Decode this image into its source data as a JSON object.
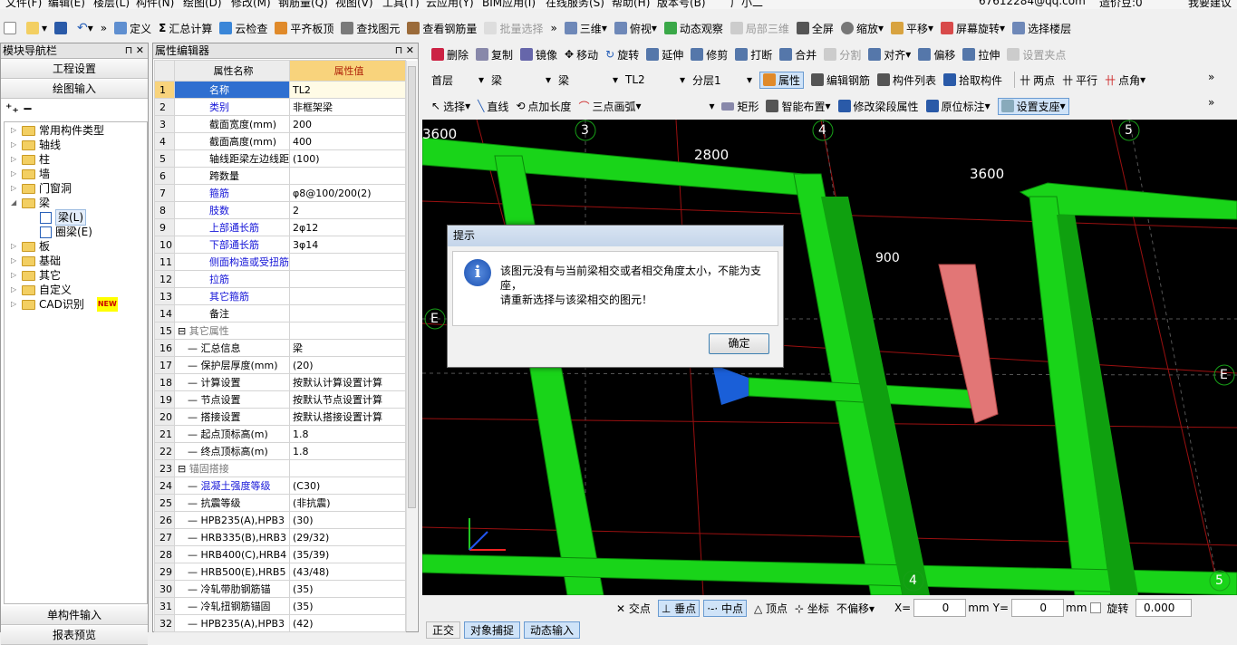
{
  "menu": {
    "items": [
      "文件(F)",
      "编辑(E)",
      "楼层(L)",
      "构件(N)",
      "绘图(D)",
      "修改(M)",
      "钢筋量(Q)",
      "视图(V)",
      "工具(T)",
      "云应用(Y)",
      "BIM应用(I)",
      "在线服务(S)",
      "帮助(H)",
      "版本号(B)",
      "广小二"
    ],
    "account": "6761228​4@qq.com",
    "coins": "造价豆:0",
    "feedback": "我要建议"
  },
  "toolbar1": {
    "define": "定义",
    "sum": "汇总计算",
    "cloud_check": "云检查",
    "align_top": "平齐板顶",
    "find": "查找图元",
    "view_rebar": "查看钢筋量",
    "batch_select": "批量选择",
    "three_d": "三维",
    "top_view": "俯视",
    "dynamic": "动态观察",
    "local_3d": "局部三维",
    "fullscreen": "全屏",
    "zoom": "缩放",
    "pan": "平移",
    "rotate_screen": "屏幕旋转",
    "select_floor": "选择楼层"
  },
  "toolbar2": {
    "delete": "删除",
    "copy": "复制",
    "mirror": "镜像",
    "move": "移动",
    "rotate": "旋转",
    "extend": "延伸",
    "trim": "修剪",
    "break": "打断",
    "merge": "合并",
    "split": "分割",
    "align": "对齐",
    "offset": "偏移",
    "stretch": "拉伸",
    "set_clamp": "设置夹点"
  },
  "toolbar3": {
    "floor": "首层",
    "type": "梁",
    "subtype": "梁",
    "name": "TL2",
    "layer": "分层1",
    "attribute": "属性",
    "edit_rebar": "编辑钢筋",
    "component_list": "构件列表",
    "pick": "拾取构件",
    "two_points": "两点",
    "parallel": "平行",
    "point_angle": "点角"
  },
  "toolbar4": {
    "select": "选择",
    "line": "直线",
    "point_length": "点加长度",
    "three_point_arc": "三点画弧",
    "rect": "矩形",
    "smart_layout": "智能布置",
    "modify_span": "修改梁段属性",
    "in_situ": "原位标注",
    "set_support": "设置支座"
  },
  "nav": {
    "title": "模块导航栏",
    "project_settings": "工程设置",
    "draw_input": "绘图输入",
    "single_input": "单构件输入",
    "report": "报表预览",
    "tree": [
      {
        "label": "常用构件类型",
        "level": 0
      },
      {
        "label": "轴线",
        "level": 0
      },
      {
        "label": "柱",
        "level": 0
      },
      {
        "label": "墙",
        "level": 0
      },
      {
        "label": "门窗洞",
        "level": 0
      },
      {
        "label": "梁",
        "level": 0,
        "open": true
      },
      {
        "label": "梁(L)",
        "level": 1
      },
      {
        "label": "圈梁(E)",
        "level": 1
      },
      {
        "label": "板",
        "level": 0
      },
      {
        "label": "基础",
        "level": 0
      },
      {
        "label": "其它",
        "level": 0
      },
      {
        "label": "自定义",
        "level": 0
      },
      {
        "label": "CAD识别",
        "level": 0,
        "badge": "NEW"
      }
    ]
  },
  "props": {
    "title": "属性编辑器",
    "col_name": "属性名称",
    "col_value": "属性值",
    "rows": [
      {
        "n": "1",
        "name": "名称",
        "value": "TL2",
        "blue": true
      },
      {
        "n": "2",
        "name": "类别",
        "value": "非框架梁",
        "blue": true
      },
      {
        "n": "3",
        "name": "截面宽度(mm)",
        "value": "200"
      },
      {
        "n": "4",
        "name": "截面高度(mm)",
        "value": "400"
      },
      {
        "n": "5",
        "name": "轴线距梁左边线距",
        "value": "(100)"
      },
      {
        "n": "6",
        "name": "跨数量",
        "value": ""
      },
      {
        "n": "7",
        "name": "箍筋",
        "value": "φ8@100/200(2)",
        "blue": true
      },
      {
        "n": "8",
        "name": "肢数",
        "value": "2",
        "blue": true
      },
      {
        "n": "9",
        "name": "上部通长筋",
        "value": "2φ12",
        "blue": true
      },
      {
        "n": "10",
        "name": "下部通长筋",
        "value": "3φ14",
        "blue": true
      },
      {
        "n": "11",
        "name": "侧面构造或受扭筋",
        "value": "",
        "blue": true
      },
      {
        "n": "12",
        "name": "拉筋",
        "value": "",
        "blue": true
      },
      {
        "n": "13",
        "name": "其它箍筋",
        "value": "",
        "blue": true
      },
      {
        "n": "14",
        "name": "备注",
        "value": ""
      },
      {
        "n": "15",
        "name": "其它属性",
        "value": "",
        "group": true
      },
      {
        "n": "16",
        "name": "汇总信息",
        "value": "梁",
        "sub": true
      },
      {
        "n": "17",
        "name": "保护层厚度(mm)",
        "value": "(20)",
        "sub": true
      },
      {
        "n": "18",
        "name": "计算设置",
        "value": "按默认计算设置计算",
        "sub": true
      },
      {
        "n": "19",
        "name": "节点设置",
        "value": "按默认节点设置计算",
        "sub": true
      },
      {
        "n": "20",
        "name": "搭接设置",
        "value": "按默认搭接设置计算",
        "sub": true
      },
      {
        "n": "21",
        "name": "起点顶标高(m)",
        "value": "1.8",
        "sub": true
      },
      {
        "n": "22",
        "name": "终点顶标高(m)",
        "value": "1.8",
        "sub": true
      },
      {
        "n": "23",
        "name": "锚固搭接",
        "value": "",
        "group": true
      },
      {
        "n": "24",
        "name": "混凝土强度等级",
        "value": "(C30)",
        "sub": true,
        "blue": true
      },
      {
        "n": "25",
        "name": "抗震等级",
        "value": "(非抗震)",
        "sub": true
      },
      {
        "n": "26",
        "name": "HPB235(A),HPB3",
        "value": "(30)",
        "sub": true
      },
      {
        "n": "27",
        "name": "HRB335(B),HRB3",
        "value": "(29/32)",
        "sub": true
      },
      {
        "n": "28",
        "name": "HRB400(C),HRB4",
        "value": "(35/39)",
        "sub": true
      },
      {
        "n": "29",
        "name": "HRB500(E),HRB5",
        "value": "(43/48)",
        "sub": true
      },
      {
        "n": "30",
        "name": "冷轧带肋钢筋锚",
        "value": "(35)",
        "sub": true
      },
      {
        "n": "31",
        "name": "冷轧扭钢筋锚固",
        "value": "(35)",
        "sub": true
      },
      {
        "n": "32",
        "name": "HPB235(A),HPB3",
        "value": "(42)",
        "sub": true
      }
    ]
  },
  "viewport": {
    "dims": [
      "3600",
      "2800",
      "3600",
      "900"
    ],
    "axes": [
      "3",
      "4",
      "5",
      "E",
      "E",
      "4",
      "5"
    ]
  },
  "dialog": {
    "title": "提示",
    "line1": "该图元没有与当前梁相交或者相交角度太小，不能为支",
    "line2": "座，",
    "line3": "请重新选择与该梁相交的图元！",
    "ok": "确定"
  },
  "statusbar": {
    "intersect": "交点",
    "perp": "垂点",
    "mid": "中点",
    "vertex": "顶点",
    "coord": "坐标",
    "offset": "不偏移",
    "x_label": "X=",
    "x_value": "0",
    "y_label": "Y=",
    "y_value": "0",
    "unit": "mm",
    "rotate_label": "旋转",
    "rotate_value": "0.000"
  },
  "bottom_tabs": {
    "t1": "正交",
    "t2": "对象捕捉",
    "t3": "动态输入"
  }
}
